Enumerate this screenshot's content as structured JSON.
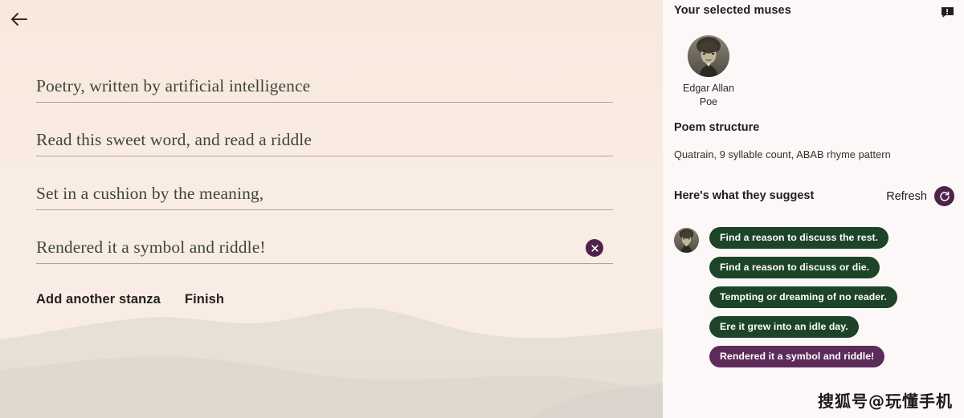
{
  "nav": {
    "back_icon": "arrow-left-icon"
  },
  "editor": {
    "lines": [
      {
        "text": "Poetry, written by artificial intelligence",
        "deletable": false
      },
      {
        "text": "Read this sweet word, and read a riddle",
        "deletable": false
      },
      {
        "text": "Set in a cushion by the meaning,",
        "deletable": false
      },
      {
        "text": "Rendered it a symbol and riddle!",
        "deletable": true
      }
    ],
    "delete_icon": "close-circle-icon",
    "actions": [
      {
        "label": "Add another stanza",
        "name": "add-another-stanza-button"
      },
      {
        "label": "Finish",
        "name": "finish-button"
      }
    ]
  },
  "sidebar": {
    "title": "Your selected muses",
    "feedback_icon": "feedback-icon",
    "muses": [
      {
        "name_line1": "Edgar Allan",
        "name_line2": "Poe",
        "avatar": "portrait-avatar"
      }
    ],
    "structure": {
      "title": "Poem structure",
      "text": "Quatrain, 9 syllable count, ABAB rhyme pattern"
    },
    "suggestions": {
      "title": "Here's what they suggest",
      "refresh_label": "Refresh",
      "refresh_icon": "refresh-icon",
      "items": [
        {
          "text": "Find a reason to discuss the rest.",
          "color": "#1d4429",
          "selected": false,
          "show_avatar": true
        },
        {
          "text": "Find a reason to discuss or die.",
          "color": "#1d4429",
          "selected": false,
          "show_avatar": false
        },
        {
          "text": "Tempting or dreaming of no reader.",
          "color": "#1d4429",
          "selected": false,
          "show_avatar": false
        },
        {
          "text": "Ere it grew into an idle day.",
          "color": "#1d4429",
          "selected": false,
          "show_avatar": false
        },
        {
          "text": "Rendered it a symbol and riddle!",
          "color": "#5c2b59",
          "selected": true,
          "show_avatar": false
        }
      ]
    }
  },
  "watermark": {
    "text": "搜狐号@玩懂手机"
  },
  "colors": {
    "accent_purple": "#4c2349",
    "chip_green": "#1d4429",
    "chip_purple": "#5c2b59",
    "main_bg": "#f9ece3",
    "sidebar_bg": "#fbf8f7",
    "poem_text": "#3f4738",
    "rule": "#7a5c72"
  }
}
